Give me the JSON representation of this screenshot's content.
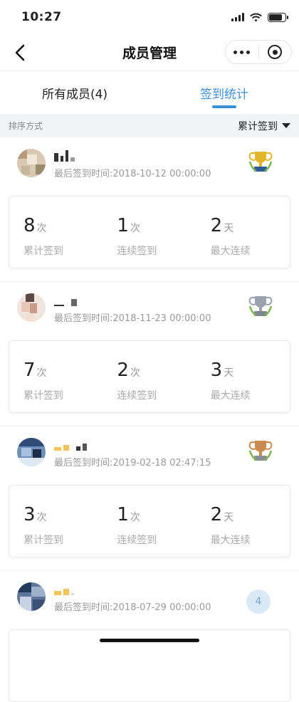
{
  "status_bar": {
    "time": "10:27"
  },
  "nav": {
    "title": "成员管理"
  },
  "tabs": [
    {
      "label": "所有成员(4)",
      "active": false
    },
    {
      "label": "签到统计",
      "active": true
    }
  ],
  "sort": {
    "label": "排序方式",
    "selected": "累计签到"
  },
  "stat_captions": {
    "total": "累计签到",
    "consecutive": "连续签到",
    "max": "最大连续"
  },
  "units": {
    "times": "次",
    "days": "天"
  },
  "members": [
    {
      "last_label": "最后签到时间:",
      "last_time": "2018-10-12 00:00:00",
      "badge": "gold-trophy-icon",
      "total": "8",
      "consecutive": "1",
      "max": "2"
    },
    {
      "last_label": "最后签到时间:",
      "last_time": "2018-11-23 00:00:00",
      "badge": "silver-trophy-icon",
      "total": "7",
      "consecutive": "2",
      "max": "3"
    },
    {
      "last_label": "最后签到时间:",
      "last_time": "2019-02-18 02:47:15",
      "badge": "bronze-trophy-icon",
      "total": "3",
      "consecutive": "1",
      "max": "2"
    },
    {
      "last_label": "最后签到时间:",
      "last_time": "2018-07-29 00:00:00",
      "rank": "4"
    }
  ],
  "colors": {
    "accent": "#3a8fd9",
    "gold": "#e3b52b",
    "silver": "#9aa3ad",
    "bronze": "#c98a52"
  }
}
